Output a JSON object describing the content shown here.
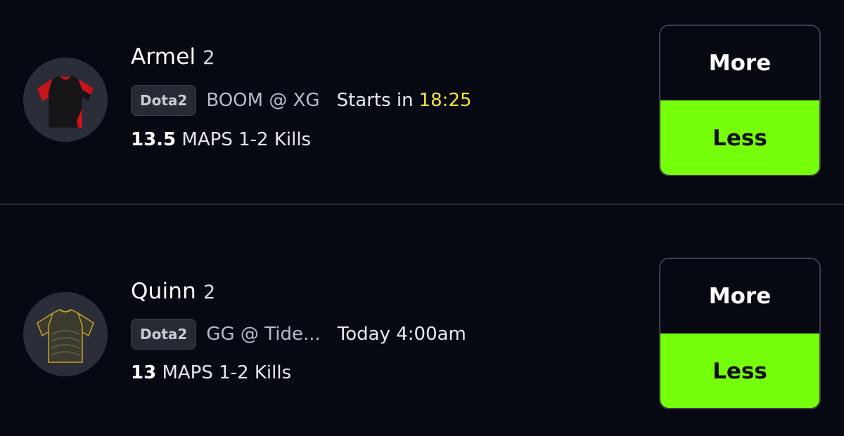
{
  "colors": {
    "background": "#060812",
    "less_button": "#75ff0a",
    "countdown": "#f4e23a",
    "divider": "#2a2d36"
  },
  "projections": [
    {
      "player_name": "Armel",
      "player_number": "2",
      "league_tag": "Dota2",
      "matchup": "BOOM @ XG",
      "time_label": "Starts in",
      "countdown": "18:25",
      "line_value": "13.5",
      "stat_label": "MAPS 1-2 Kills",
      "jersey_icon": "red-black-jersey-icon",
      "more_label": "More",
      "less_label": "Less"
    },
    {
      "player_name": "Quinn",
      "player_number": "2",
      "league_tag": "Dota2",
      "matchup": "GG @ Tide...",
      "time_label": "Today 4:00am",
      "countdown": "",
      "line_value": "13",
      "stat_label": "MAPS 1-2 Kills",
      "jersey_icon": "black-gold-jersey-icon",
      "more_label": "More",
      "less_label": "Less"
    }
  ]
}
